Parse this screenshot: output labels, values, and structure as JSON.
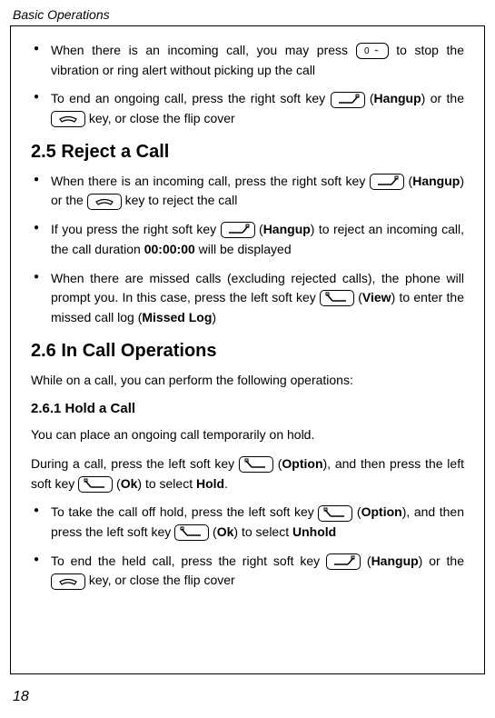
{
  "header": "Basic Operations",
  "pageNumber": "18",
  "section1": {
    "b1_a": "When there is an incoming call, you may press ",
    "b1_b": " to stop the vibration or ring alert without picking up the call",
    "b2_a": "To end an ongoing call, press the right soft key ",
    "b2_b": " (",
    "b2_bold": "Hangup",
    "b2_c": ") or the ",
    "b2_d": " key, or close the flip cover"
  },
  "h25": "2.5 Reject a Call",
  "section25": {
    "b1_a": "When there is an incoming call, press the right soft key ",
    "b1_b": " (",
    "b1_bold": "Hangup",
    "b1_c": ") or the ",
    "b1_d": " key to reject the call",
    "b2_a": "If you press the right soft key ",
    "b2_b": " (",
    "b2_bold": "Hangup",
    "b2_c": ") to reject an incoming call, the call duration ",
    "b2_bold2": "00:00:00",
    "b2_d": " will be displayed",
    "b3_a": "When there are missed calls (excluding rejected calls), the phone will prompt you. In this case, press the left soft key ",
    "b3_b": " (",
    "b3_bold": "View",
    "b3_c": ") to enter the missed call log (",
    "b3_bold2": "Missed Log",
    "b3_d": ")"
  },
  "h26": "2.6 In Call Operations",
  "p26": "While on a call, you can perform the following operations:",
  "h261": "2.6.1 Hold a Call",
  "p261a": "You can place an ongoing call temporarily on hold.",
  "p261b_a": "During a call, press the left soft key ",
  "p261b_b": " (",
  "p261b_bold": "Option",
  "p261b_c": "), and then press the left soft key ",
  "p261b_d": " (",
  "p261b_bold2": "Ok",
  "p261b_e": ") to select ",
  "p261b_bold3": "Hold",
  "p261b_f": ".",
  "section261": {
    "b1_a": "To take the call off hold, press the left soft key ",
    "b1_b": " (",
    "b1_bold": "Option",
    "b1_c": "), and then press the left soft key ",
    "b1_d": " (",
    "b1_bold2": "Ok",
    "b1_e": ") to select ",
    "b1_bold3": "Unhold",
    "b2_a": "To end the held call, press the right soft key ",
    "b2_b": " (",
    "b2_bold": "Hangup",
    "b2_c": ") or the ",
    "b2_d": " key, or close the flip cover"
  },
  "keys": {
    "zero": "0",
    "lock": "⌁"
  }
}
